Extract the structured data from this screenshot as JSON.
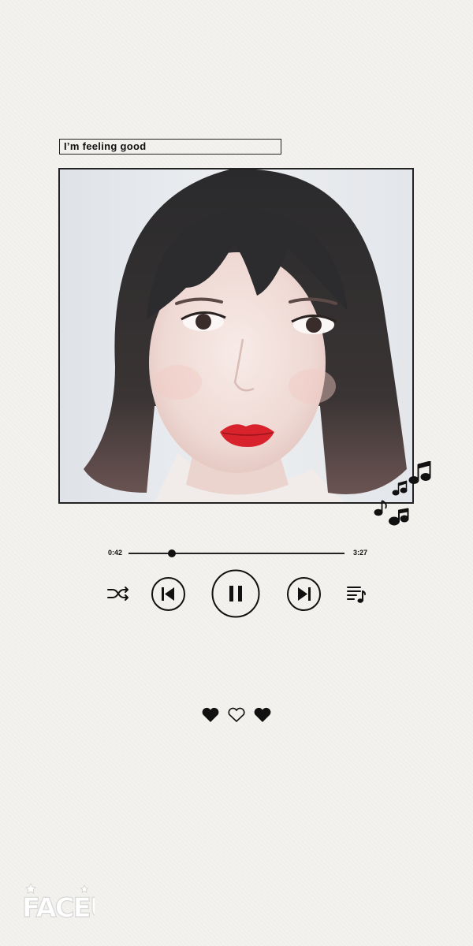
{
  "song": {
    "title": "I’m feeling good"
  },
  "player": {
    "elapsed": "0:42",
    "total": "3:27",
    "progress_fraction": 0.2,
    "state": "playing"
  },
  "controls": {
    "icons": [
      "shuffle-icon",
      "previous-icon",
      "pause-icon",
      "next-icon",
      "playlist-icon"
    ]
  },
  "decorations": {
    "hearts": [
      "filled-heart",
      "outline-heart",
      "filled-heart"
    ],
    "notes_icon": "music-notes-icon"
  },
  "watermark": {
    "text": "FACEU"
  },
  "colors": {
    "background": "#f4f2ee",
    "ink": "#111111",
    "lips": "#d8232c"
  }
}
